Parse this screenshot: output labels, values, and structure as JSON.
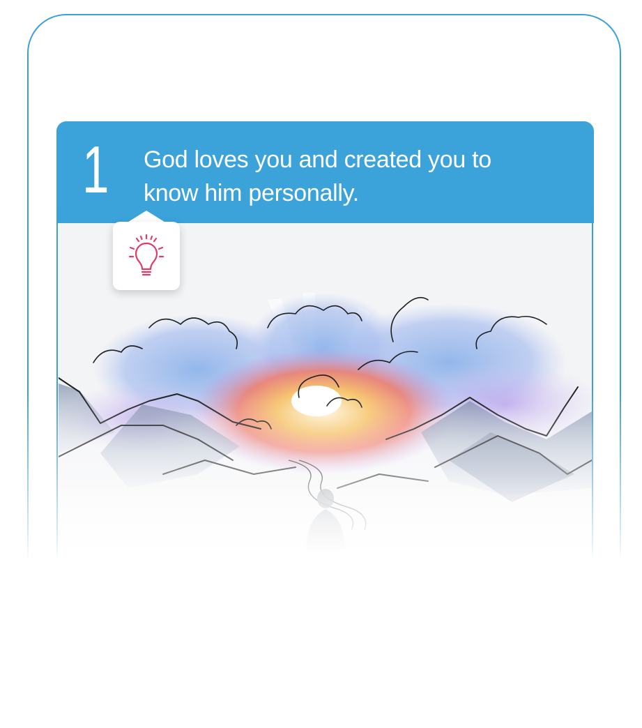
{
  "step": {
    "number": "1",
    "text": "God loves you and created you to know him personally."
  },
  "badge": {
    "icon": "lightbulb-icon",
    "icon_color": "#e23a68"
  },
  "colors": {
    "accent": "#3ba3da",
    "frame": "#3aa0d8"
  },
  "illustration": {
    "subject": "watercolor sunrise over mountains with figure"
  }
}
